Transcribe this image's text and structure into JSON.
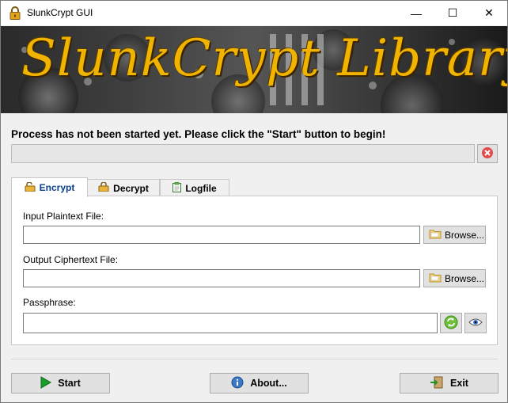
{
  "window": {
    "title": "SlunkCrypt GUI",
    "controls": {
      "minimize": "—",
      "maximize": "☐",
      "close": "✕"
    }
  },
  "banner": {
    "title": "SlunkCrypt Library"
  },
  "status": {
    "message": "Process has not been started yet. Please click the \"Start\" button to begin!",
    "progress": 0
  },
  "tabs": [
    {
      "label": "Encrypt",
      "icon": "lock-open-icon",
      "active": true
    },
    {
      "label": "Decrypt",
      "icon": "lock-closed-icon",
      "active": false
    },
    {
      "label": "Logfile",
      "icon": "clipboard-icon",
      "active": false
    }
  ],
  "encrypt": {
    "input_label": "Input Plaintext File:",
    "input_value": "",
    "output_label": "Output Ciphertext File:",
    "output_value": "",
    "passphrase_label": "Passphrase:",
    "passphrase_value": "",
    "browse_label": "Browse..."
  },
  "buttons": {
    "start": "Start",
    "about": "About...",
    "exit": "Exit"
  },
  "colors": {
    "banner_text": "#f0b400",
    "active_tab_text": "#0b3f8a",
    "start_icon": "#1a9c2a",
    "abort_icon": "#e04b4b"
  }
}
